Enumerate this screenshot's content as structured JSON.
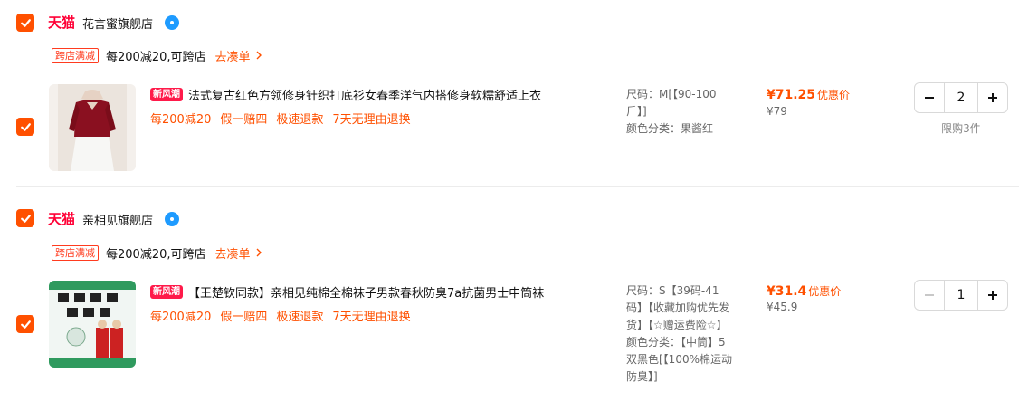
{
  "colors": {
    "accent": "#ff5000",
    "tmall": "#ff0036",
    "badge": "#1e9bff"
  },
  "stores": [
    {
      "logo": "天猫",
      "name": "花言蜜旗舰店",
      "promo": {
        "tag": "跨店满减",
        "text": "每200减20,可跨店",
        "link": "去凑单"
      },
      "item": {
        "badge": "新风潮",
        "title": "法式复古红色方领修身针织打底衫女春季洋气内搭修身软糯舒适上衣",
        "services": [
          "每200减20",
          "假一赔四",
          "极速退款",
          "7天无理由退换"
        ],
        "sku": [
          "尺码：M[【90-100斤】]",
          "颜色分类：果酱红"
        ],
        "price_now": "¥71.25",
        "price_label": "优惠价",
        "price_old": "¥79",
        "quantity": "2",
        "limit": "限购3件",
        "minus_enabled": true
      }
    },
    {
      "logo": "天猫",
      "name": "亲相见旗舰店",
      "promo": {
        "tag": "跨店满减",
        "text": "每200减20,可跨店",
        "link": "去凑单"
      },
      "item": {
        "badge": "新风潮",
        "title": "【王楚钦同款】亲相见纯棉全棉袜子男款春秋防臭7a抗菌男士中筒袜",
        "services": [
          "每200减20",
          "假一赔四",
          "极速退款",
          "7天无理由退换"
        ],
        "sku": [
          "尺码：S【39码-41码】【收藏加购优先发货】【☆赠运费险☆】",
          "颜色分类：【中筒】5双黑色[【100%棉运动防臭】]"
        ],
        "price_now": "¥31.4",
        "price_label": "优惠价",
        "price_old": "¥45.9",
        "quantity": "1",
        "minus_enabled": false
      }
    }
  ]
}
